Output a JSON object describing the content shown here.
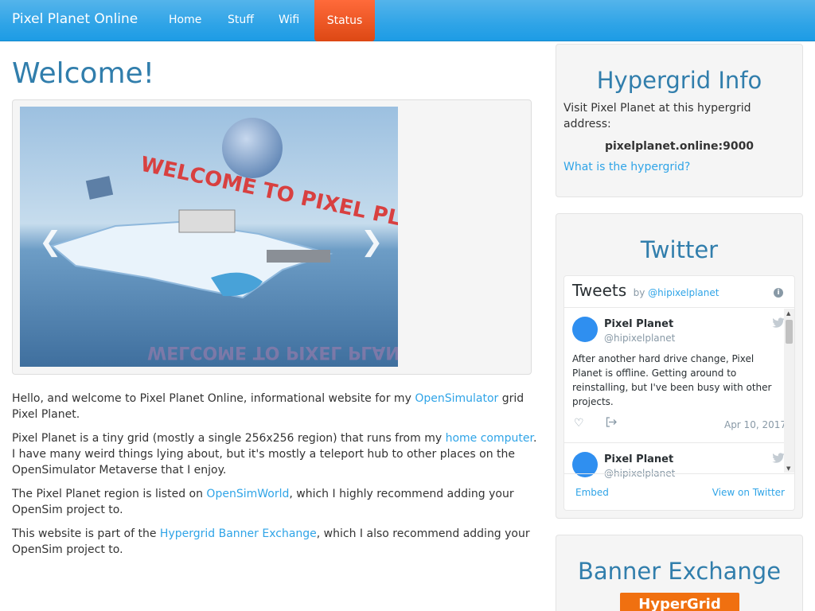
{
  "nav": {
    "brand": "Pixel Planet Online",
    "items": [
      {
        "label": "Home"
      },
      {
        "label": "Stuff"
      },
      {
        "label": "Wifi"
      },
      {
        "label": "Status",
        "active": true
      }
    ]
  },
  "main": {
    "title": "Welcome!",
    "carousel": {
      "image_text": "WELCOME TO PIXEL PLANET",
      "prev_icon": "chevron-left-icon",
      "next_icon": "chevron-right-icon"
    },
    "paragraphs": {
      "p1_a": "Hello, and welcome to Pixel Planet Online, informational website for my ",
      "p1_link": "OpenSimulator",
      "p1_b": " grid Pixel Planet.",
      "p2_a": "Pixel Planet is a tiny grid (mostly a single 256x256 region) that runs from my ",
      "p2_link": "home computer",
      "p2_b": ". I have many weird things lying about, but it's mostly a teleport hub to other places on the OpenSimulator Metaverse that I enjoy.",
      "p3_a": "The Pixel Planet region is listed on ",
      "p3_link": "OpenSimWorld",
      "p3_b": ", which I highly recommend adding your OpenSim project to.",
      "p4_a": "This website is part of the ",
      "p4_link": "Hypergrid Banner Exchange",
      "p4_b": ", which I also recommend adding your OpenSim project to."
    }
  },
  "sidebar": {
    "hypergrid": {
      "title": "Hypergrid Info",
      "text": "Visit Pixel Planet at this hypergrid address:",
      "address": "pixelplanet.online:9000",
      "link": "What is the hypergrid?"
    },
    "twitter": {
      "title": "Twitter",
      "widget_title": "Tweets",
      "by": "by",
      "handle_link": "@hipixelplanet",
      "tweets": [
        {
          "name": "Pixel Planet",
          "handle": "@hipixelplanet",
          "text": "After another hard drive change, Pixel Planet is offline. Getting around to reinstalling, but I've been busy with other projects.",
          "date": "Apr 10, 2017"
        },
        {
          "name": "Pixel Planet",
          "handle": "@hipixelplanet"
        }
      ],
      "embed": "Embed",
      "view": "View on Twitter"
    },
    "banner_exchange": {
      "title": "Banner Exchange",
      "banner_text": "HyperGrid"
    }
  },
  "colors": {
    "navbar": "#2fa4e7",
    "active_tab": "#dd4814",
    "heading": "#317eac",
    "link": "#2fa4e7"
  }
}
